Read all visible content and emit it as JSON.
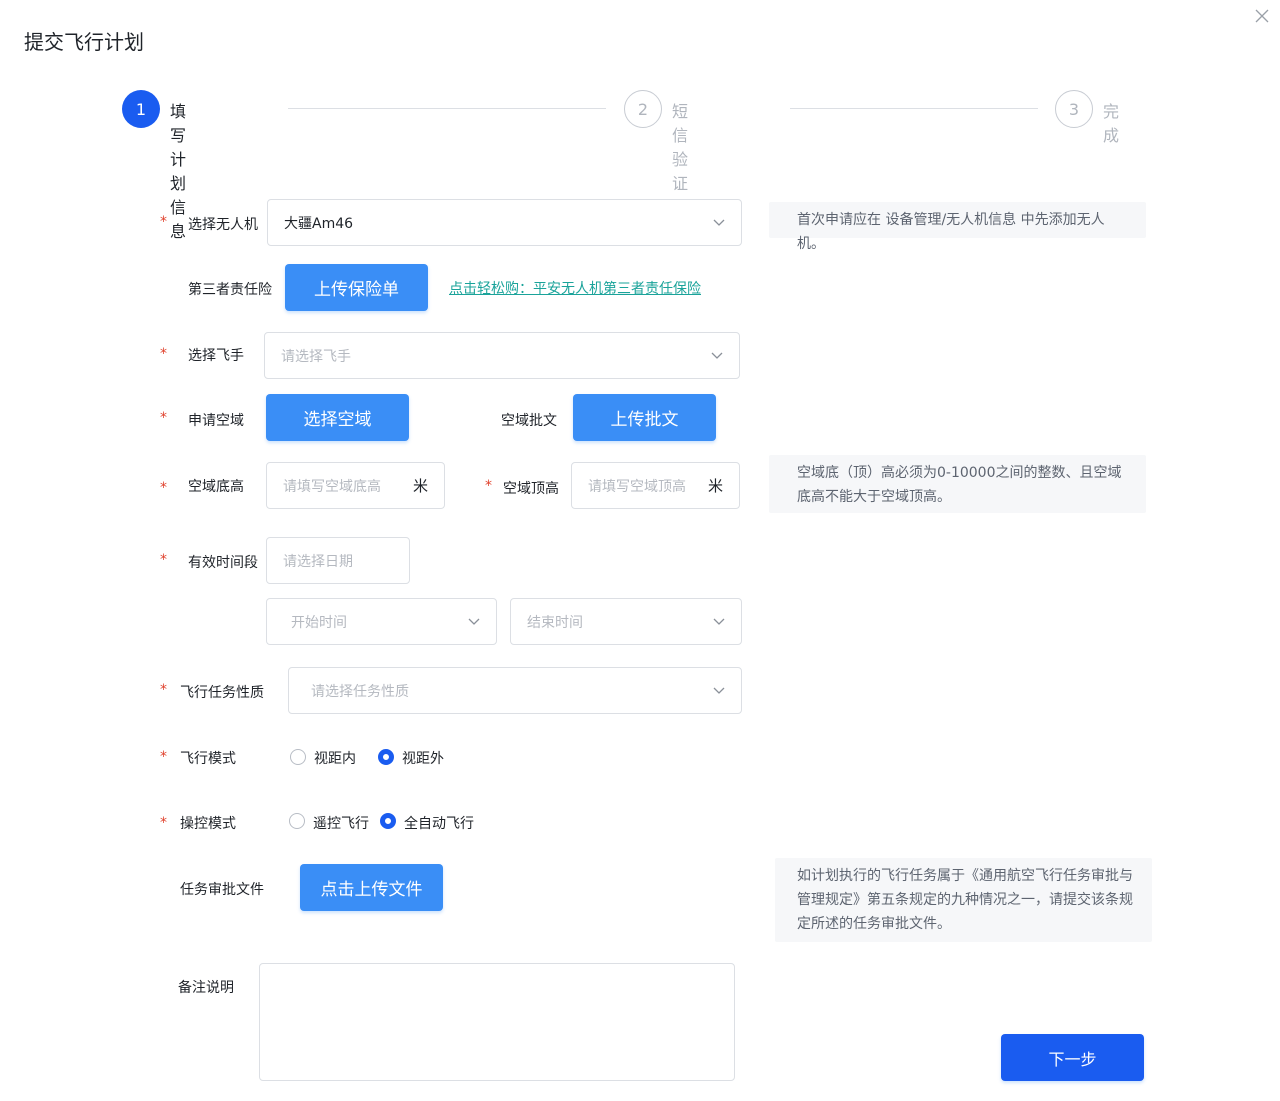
{
  "header": {
    "title": "提交飞行计划"
  },
  "steps": [
    {
      "num": "1",
      "label": "填写计划信息"
    },
    {
      "num": "2",
      "label": "短信验证"
    },
    {
      "num": "3",
      "label": "完成"
    }
  ],
  "required_mark": "*",
  "form": {
    "drone": {
      "label": "选择无人机",
      "value": "大疆Am46",
      "hint": "首次申请应在 设备管理/无人机信息 中先添加无人机。"
    },
    "insurance": {
      "label": "第三者责任险",
      "button": "上传保险单",
      "link": "点击轻松购：平安无人机第三者责任保险"
    },
    "pilot": {
      "label": "选择飞手",
      "placeholder": "请选择飞手"
    },
    "airspace": {
      "label": "申请空域",
      "button": "选择空域",
      "approval_label": "空域批文",
      "approval_button": "上传批文"
    },
    "altitude": {
      "bottom_label": "空域底高",
      "bottom_placeholder": "请填写空域底高",
      "top_label": "空域顶高",
      "top_placeholder": "请填写空域顶高",
      "unit": "米",
      "hint": "空域底（顶）高必须为0-10000之间的整数、且空域底高不能大于空域顶高。"
    },
    "period": {
      "label": "有效时间段",
      "date_placeholder": "请选择日期",
      "start_placeholder": "开始时间",
      "end_placeholder": "结束时间"
    },
    "task_nature": {
      "label": "飞行任务性质",
      "placeholder": "请选择任务性质"
    },
    "flight_mode": {
      "label": "飞行模式",
      "options": [
        "视距内",
        "视距外"
      ],
      "selected": "视距外"
    },
    "control_mode": {
      "label": "操控模式",
      "options": [
        "遥控飞行",
        "全自动飞行"
      ],
      "selected": "全自动飞行"
    },
    "task_file": {
      "label": "任务审批文件",
      "button": "点击上传文件",
      "hint": "如计划执行的飞行任务属于《通用航空飞行任务审批与管理规定》第五条规定的九种情况之一，请提交该条规定所述的任务审批文件。"
    },
    "remarks": {
      "label": "备注说明",
      "value": ""
    }
  },
  "footer": {
    "next_button": "下一步"
  },
  "colors": {
    "primary": "#1a5cf0",
    "button": "#3a8ef6",
    "required": "#e0412c",
    "link": "#1aa39a"
  }
}
